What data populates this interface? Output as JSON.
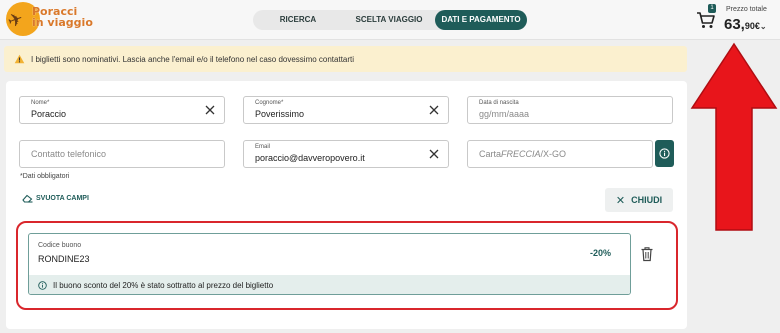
{
  "logo": {
    "line1": "Poracci",
    "line2": "in viaggio"
  },
  "steps": [
    {
      "label": "RICERCA",
      "active": false
    },
    {
      "label": "SCELTA VIAGGIO",
      "active": false
    },
    {
      "label": "DATI E PAGAMENTO",
      "active": true
    }
  ],
  "cart": {
    "badge": "1",
    "price_label": "Prezzo totale",
    "price_main": "63,",
    "price_cents": "90€"
  },
  "warning": {
    "text": "I biglietti sono nominativi. Lascia anche l'email e/o il telefono nel caso dovessimo contattarti"
  },
  "form": {
    "nome": {
      "label": "Nome*",
      "value": "Poraccio"
    },
    "cognome": {
      "label": "Cognome*",
      "value": "Poverissimo"
    },
    "nascita": {
      "label": "Data di nascita",
      "placeholder": "gg/mm/aaaa"
    },
    "telefono": {
      "placeholder": "Contatto telefonico"
    },
    "email": {
      "label": "Email",
      "value": "poraccio@davveropovero.it"
    },
    "carta": {
      "prefix": "Carta",
      "italic": "FRECCIA",
      "suffix": "/X-GO"
    },
    "required_note": "*Dati obbligatori",
    "clear_label": "SVUOTA CAMPI",
    "close_label": "CHIUDI"
  },
  "coupon": {
    "label": "Codice buono",
    "value": "RONDINE23",
    "discount": "-20%",
    "info": "Il buono sconto del 20% è stato sottratto al prezzo del biglietto"
  },
  "colors": {
    "accent": "#1f5c59",
    "highlight": "#d9262c",
    "warning_bg": "#fbf0cf",
    "logo": "#f3a51c"
  }
}
